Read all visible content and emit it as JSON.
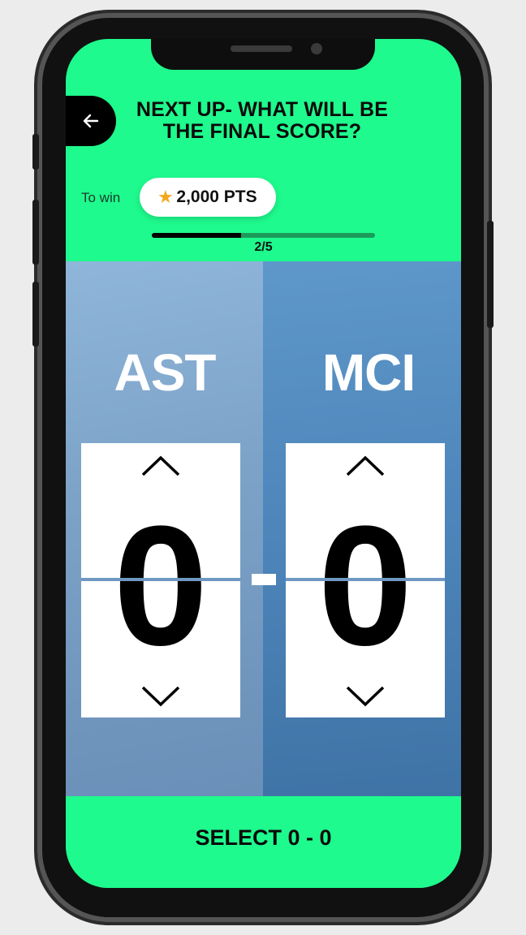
{
  "header": {
    "title": "NEXT UP- WHAT WILL BE THE FINAL SCORE?",
    "back_icon": "arrow-left-icon"
  },
  "reward": {
    "label": "To win",
    "icon": "star-icon",
    "points": "2,000 PTS"
  },
  "progress": {
    "current": 2,
    "total": 5,
    "text": "2/5"
  },
  "match": {
    "home": {
      "team": "AST",
      "score": "0"
    },
    "away": {
      "team": "MCI",
      "score": "0"
    },
    "separator": "-"
  },
  "footer": {
    "button_label": "SELECT 0 - 0"
  },
  "colors": {
    "accent": "#1efa8d",
    "star": "#f2a81d",
    "pitch_left": "#7da3c8",
    "pitch_right": "#4f87bc"
  }
}
